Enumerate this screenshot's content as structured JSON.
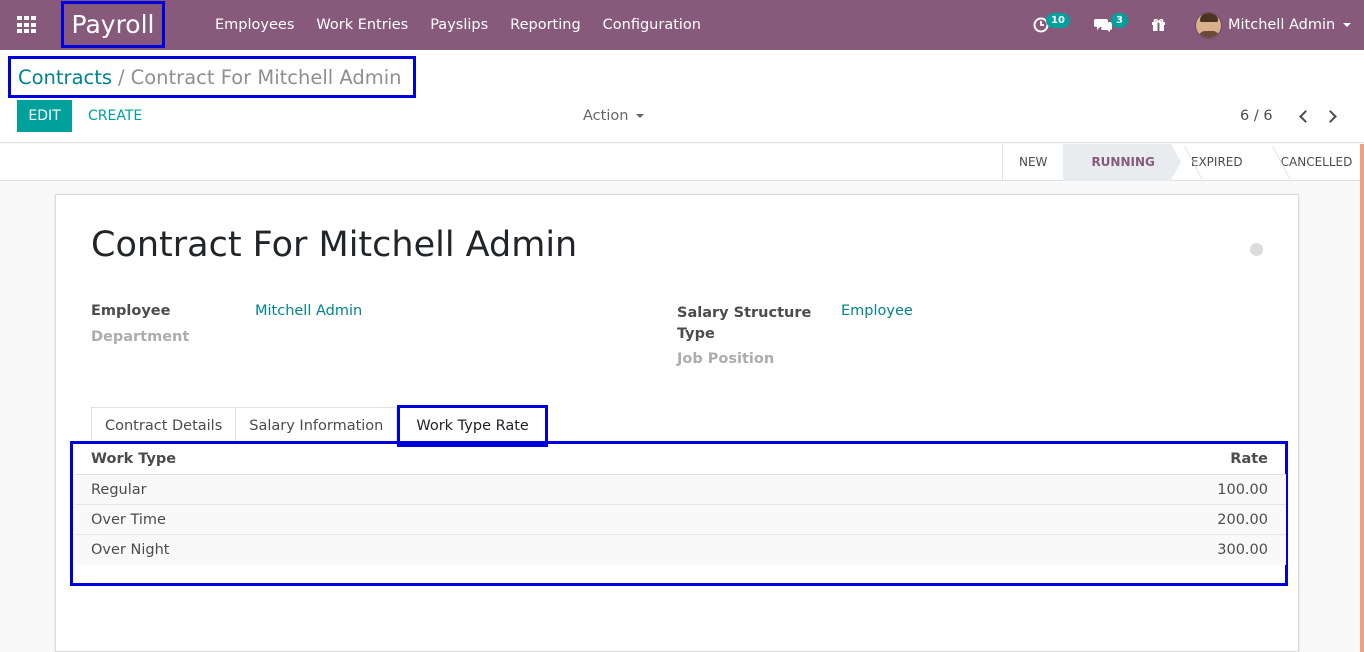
{
  "navbar": {
    "app_title": "Payroll",
    "menu": [
      "Employees",
      "Work Entries",
      "Payslips",
      "Reporting",
      "Configuration"
    ],
    "activity_count": "10",
    "message_count": "3",
    "user_name": "Mitchell Admin"
  },
  "control_panel": {
    "breadcrumb_parent": "Contracts",
    "breadcrumb_sep": "/",
    "breadcrumb_current": "Contract For Mitchell Admin",
    "edit_label": "EDIT",
    "create_label": "CREATE",
    "action_label": "Action",
    "pager_value": "6 / 6"
  },
  "statusbar": {
    "stages": [
      "NEW",
      "RUNNING",
      "EXPIRED",
      "CANCELLED"
    ],
    "active_stage": "RUNNING"
  },
  "form": {
    "title": "Contract For Mitchell Admin",
    "employee_label": "Employee",
    "employee_value": "Mitchell Admin",
    "department_label": "Department",
    "salary_structure_label_line1": "Salary Structure",
    "salary_structure_label_line2": "Type",
    "salary_structure_value": "Employee",
    "job_position_label": "Job Position"
  },
  "tabs": [
    "Contract Details",
    "Salary Information",
    "Work Type Rate"
  ],
  "active_tab": "Work Type Rate",
  "work_type_table": {
    "headers": [
      "Work Type",
      "Rate"
    ],
    "rows": [
      {
        "work_type": "Regular",
        "rate": "100.00"
      },
      {
        "work_type": "Over Time",
        "rate": "200.00"
      },
      {
        "work_type": "Over Night",
        "rate": "300.00"
      }
    ]
  },
  "colors": {
    "navbar": "#875a7b",
    "primary": "#00a09d",
    "link": "#00838f",
    "highlight_border": "#0000dd"
  }
}
